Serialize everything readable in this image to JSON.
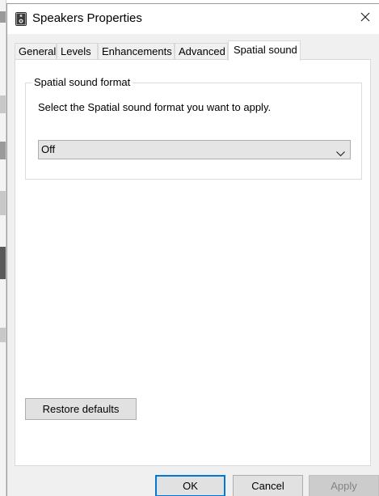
{
  "window": {
    "title": "Speakers Properties",
    "icon": "speaker-icon",
    "close_icon": "close-icon"
  },
  "tabs": [
    {
      "label": "General",
      "active": false
    },
    {
      "label": "Levels",
      "active": false
    },
    {
      "label": "Enhancements",
      "active": false
    },
    {
      "label": "Advanced",
      "active": false
    },
    {
      "label": "Spatial sound",
      "active": true
    }
  ],
  "spatial": {
    "group_label": "Spatial sound format",
    "description": "Select the Spatial sound format you want to apply.",
    "format_selected": "Off",
    "dropdown_icon": "chevron-down-icon"
  },
  "buttons": {
    "restore_defaults": "Restore defaults",
    "ok": "OK",
    "cancel": "Cancel",
    "apply": "Apply"
  },
  "colors": {
    "focus_border": "#0078d7",
    "disabled_text": "#838383",
    "client_bg": "#f0f0f0"
  }
}
